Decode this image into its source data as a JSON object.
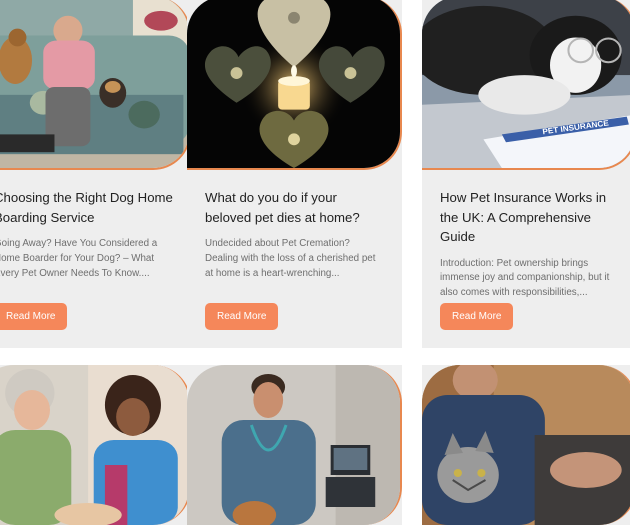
{
  "cards": [
    {
      "title": "Choosing the Right Dog Home Boarding Service",
      "excerpt": "Going Away? Have You Considered a Home Boarder for Your Dog? – What Every Pet Owner Needs To Know....",
      "button": "Read More",
      "image": "man-with-dogs-on-sofa"
    },
    {
      "title": "What do you do if your beloved pet dies at home?",
      "excerpt": "Undecided about Pet Cremation? Dealing with the loss of a cherished pet at home is a heart-wrenching...",
      "button": "Read More",
      "image": "paw-print-hearts-candle"
    },
    {
      "title": "How Pet Insurance Works in the UK: A Comprehensive Guide",
      "excerpt": "Introduction: Pet ownership brings immense joy and companionship, but it also comes with responsibilities,...",
      "button": "Read More",
      "image": "dog-with-glasses-insurance-form",
      "image_text": "PET INSURANCE"
    },
    {
      "image": "women-with-pet"
    },
    {
      "image": "vet-with-dog"
    },
    {
      "image": "man-with-cat"
    }
  ],
  "colors": {
    "accent": "#f5875a",
    "card_bg": "#eeeeee",
    "border": "#e8884f"
  }
}
